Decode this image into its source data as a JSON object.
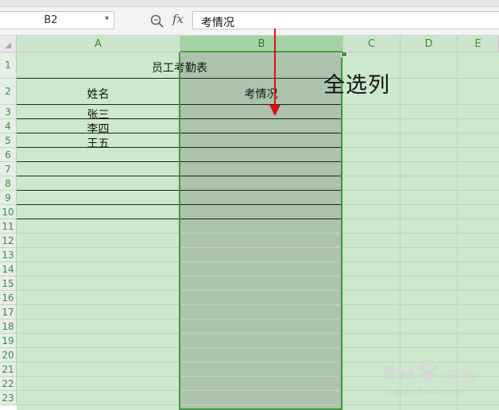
{
  "namebox": {
    "value": "B2"
  },
  "formula_bar": {
    "fx_label": "fx",
    "value": "考情况"
  },
  "columns": [
    "A",
    "B",
    "C",
    "D",
    "E"
  ],
  "rows": [
    "1",
    "2",
    "3",
    "4",
    "5",
    "6",
    "7",
    "8",
    "9",
    "10",
    "11",
    "12",
    "13",
    "14",
    "15",
    "16",
    "17",
    "18",
    "19",
    "20",
    "21",
    "22",
    "23"
  ],
  "cells": {
    "title": "员工考勤表",
    "header_name": "姓名",
    "header_status": "考情况",
    "names": [
      "张三",
      "李四",
      "王五"
    ]
  },
  "annotation": "全选列",
  "colors": {
    "selection": "#3f9b3f",
    "selected_fill": "#cde8cd",
    "arrow": "#e01010"
  },
  "watermark": {
    "brand": "Bai",
    "jingyan": "经验",
    "url": "jingyan.baidu.com"
  }
}
